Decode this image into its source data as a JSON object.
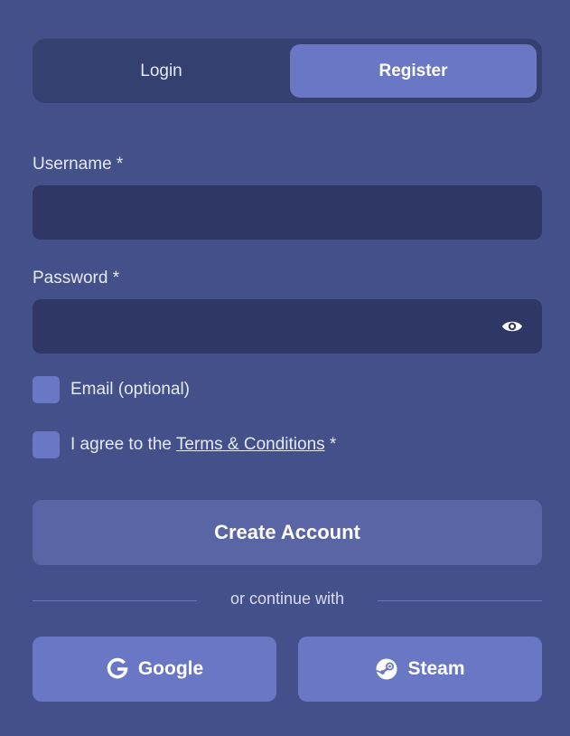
{
  "tabs": {
    "login": "Login",
    "register": "Register",
    "active": "register"
  },
  "form": {
    "username_label": "Username *",
    "username_value": "",
    "password_label": "Password *",
    "password_value": "",
    "email_checkbox_label": "Email (optional)",
    "email_checked": false,
    "agree_prefix": "I agree to the ",
    "terms_link": "Terms & Conditions",
    "agree_suffix": " *",
    "agree_checked": false,
    "submit_label": "Create Account"
  },
  "divider_text": "or continue with",
  "social": {
    "google": "Google",
    "steam": "Steam"
  },
  "icons": {
    "password_toggle": "eye-icon",
    "google": "google-icon",
    "steam": "steam-icon"
  },
  "colors": {
    "background": "#435089",
    "tab_track": "#34406f",
    "accent": "#6a77c4",
    "input_bg": "#2e3765",
    "primary_button": "#5a65a6"
  }
}
